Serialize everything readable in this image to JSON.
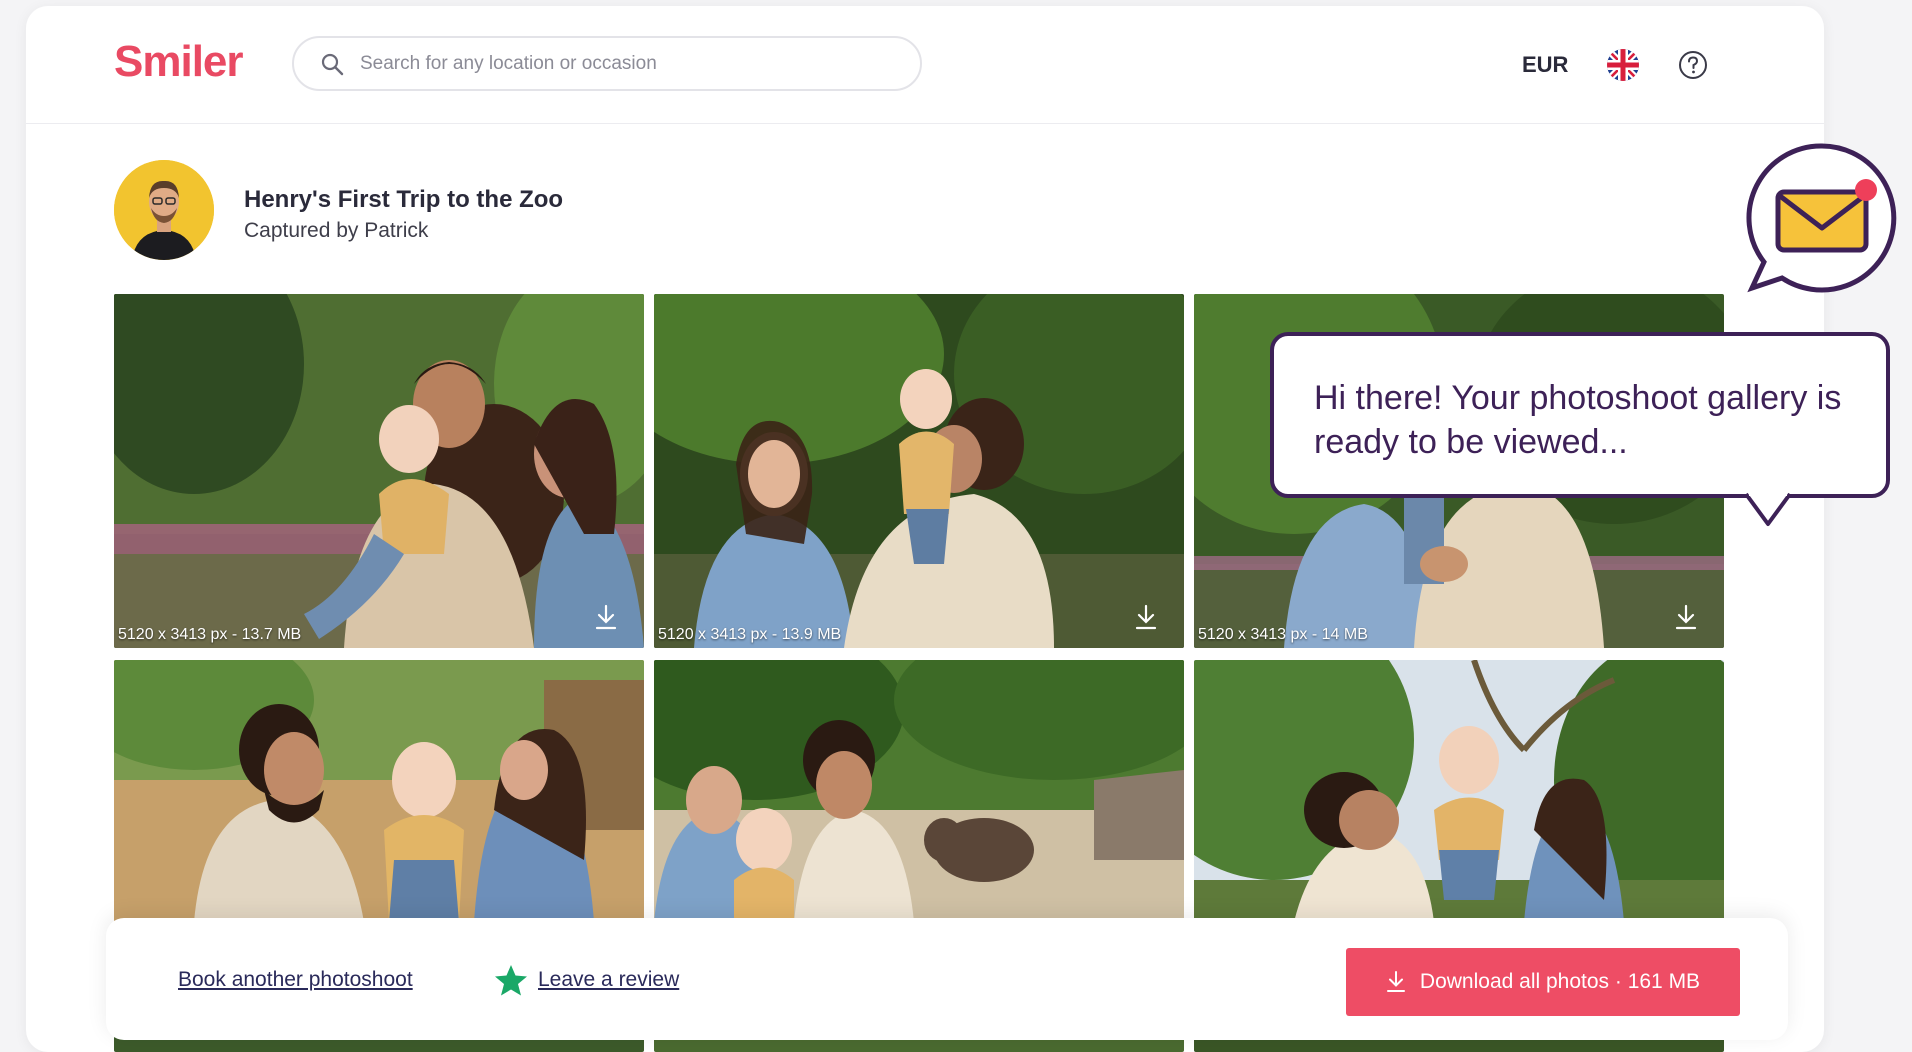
{
  "header": {
    "logo_text": "Smiler",
    "search_placeholder": "Search for any location or occasion",
    "currency": "EUR",
    "icons": {
      "search": "search-icon",
      "flag": "uk-flag-icon",
      "help": "help-circle-icon"
    }
  },
  "album": {
    "title": "Henry's First Trip to the Zoo",
    "subtitle": "Captured by Patrick"
  },
  "photos": [
    {
      "meta": "5120 x 3413 px - 13.7 MB"
    },
    {
      "meta": "5120 x 3413 px - 13.9 MB"
    },
    {
      "meta": "5120 x 3413 px - 14 MB"
    },
    {
      "meta": ""
    },
    {
      "meta": ""
    },
    {
      "meta": ""
    }
  ],
  "actions": {
    "book_label": "Book another photoshoot",
    "review_label": "Leave a review",
    "download_label": "Download all photos · 161 MB"
  },
  "notification": {
    "message": "Hi there! Your photoshoot gallery is ready to be viewed..."
  },
  "colors": {
    "brand": "#e94a63",
    "button": "#ee4d65",
    "bubble_border": "#3d2157",
    "star": "#1aa867",
    "avatar_bg": "#f2c42f"
  }
}
